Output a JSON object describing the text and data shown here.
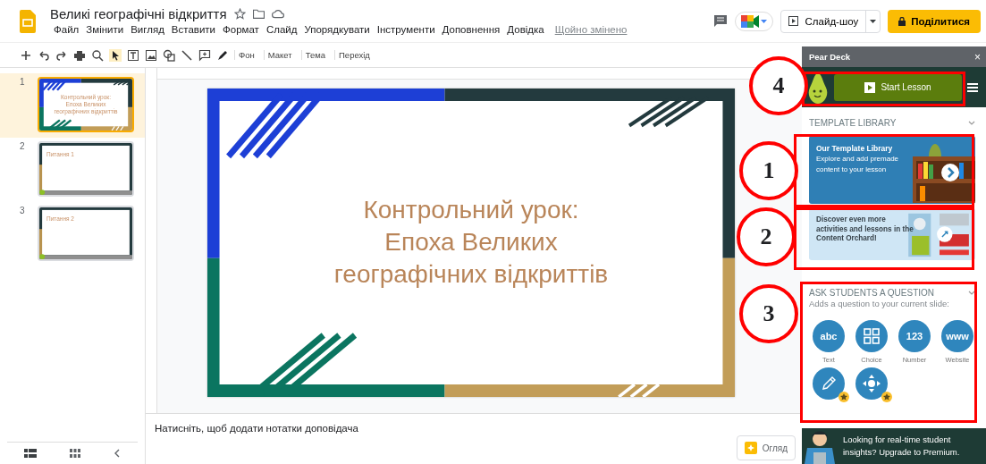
{
  "app": {
    "title": "Великі географічні відкриття",
    "menu": [
      "Файл",
      "Змінити",
      "Вигляд",
      "Вставити",
      "Формат",
      "Слайд",
      "Упорядкувати",
      "Інструменти",
      "Доповнення",
      "Довідка"
    ],
    "saved_status": "Щойно змінено",
    "toolbar_labels": [
      "Фон",
      "Макет",
      "Тема",
      "Перехід"
    ],
    "slideshow_button": "Слайд-шоу",
    "share_button": "Поділитися"
  },
  "filmstrip": [
    {
      "number": "1",
      "kind": "title",
      "selected": true,
      "title": "Контрольний урок:\nЕпоха Великих\nгеографічних відкриттів"
    },
    {
      "number": "2",
      "kind": "question",
      "selected": false,
      "title": "Питання 1"
    },
    {
      "number": "3",
      "kind": "question",
      "selected": false,
      "title": "Питання 2"
    }
  ],
  "slide": {
    "title": "Контрольний урок:\nЕпоха Великих\nгеографічних відкриттів"
  },
  "notes": {
    "placeholder": "Натисніть, щоб додати нотатки доповідача"
  },
  "explore_button": "Огляд",
  "pear_deck": {
    "title": "Pear Deck",
    "close": "×",
    "start_button": "Start Lesson",
    "template_section": {
      "heading": "TEMPLATE LIBRARY",
      "cards": [
        {
          "kind": "library",
          "title": "Our Template Library",
          "text": "Explore and add premade content to your lesson"
        },
        {
          "kind": "orchard",
          "text": "Discover even more activities and lessons in the Content Orchard!"
        }
      ]
    },
    "question_section": {
      "heading": "ASK STUDENTS A QUESTION",
      "subtitle": "Adds a question to your current slide:",
      "types": [
        {
          "kind": "text",
          "icon_text": "abc",
          "label": "Text",
          "premium": false
        },
        {
          "kind": "choice",
          "label": "Choice",
          "premium": false
        },
        {
          "kind": "number",
          "icon_text": "123",
          "label": "Number",
          "premium": false
        },
        {
          "kind": "website",
          "icon_text": "www",
          "label": "Website",
          "premium": false
        },
        {
          "kind": "draw",
          "premium": true
        },
        {
          "kind": "drag",
          "premium": true
        }
      ]
    },
    "promo": "Looking for real-time student insights? Upgrade to Premium."
  },
  "annotations": [
    {
      "number": "4"
    },
    {
      "number": "1"
    },
    {
      "number": "2"
    },
    {
      "number": "3"
    }
  ]
}
